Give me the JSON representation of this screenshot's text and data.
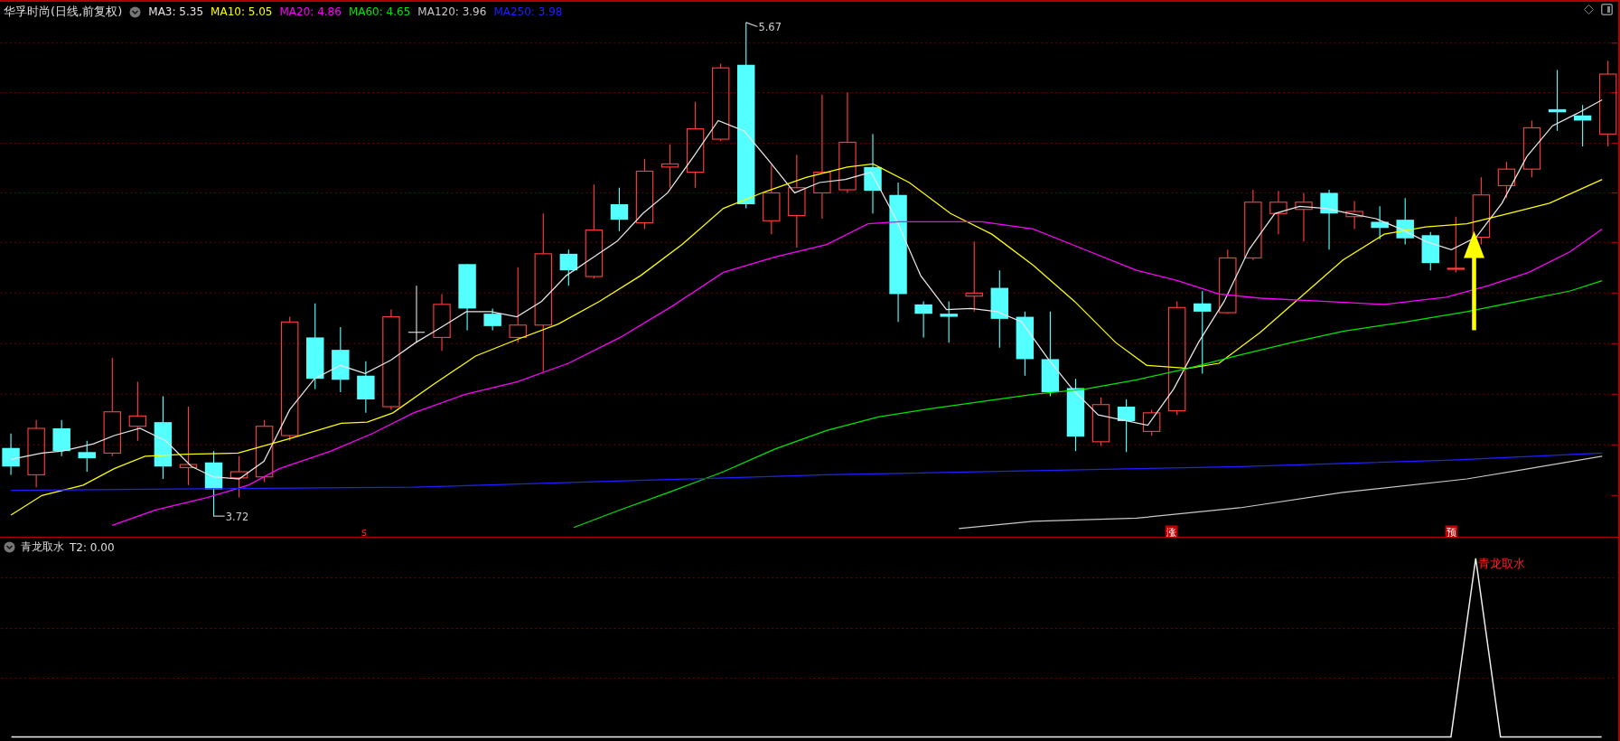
{
  "main_panel": {
    "title": "华孚时尚(日线,前复权)",
    "indicators": [
      {
        "label": "MA3: 5.35",
        "color": "#e6e6e6"
      },
      {
        "label": "MA10: 5.05",
        "color": "#ffff00"
      },
      {
        "label": "MA20: 4.86",
        "color": "#ff00ff"
      },
      {
        "label": "MA60: 4.65",
        "color": "#00e600"
      },
      {
        "label": "MA120: 3.96",
        "color": "#c8c8c8"
      },
      {
        "label": "MA250: 3.98",
        "color": "#2020ff"
      }
    ],
    "high_label": "5.67",
    "low_label": "3.72",
    "signals": [
      {
        "text": "s",
        "kind": "plain"
      },
      {
        "text": "涨",
        "kind": "boxed"
      },
      {
        "text": "预",
        "kind": "boxed"
      }
    ]
  },
  "sub_panel": {
    "title": "青龙取水",
    "value": "T2: 0.00",
    "signal_label": "青龙取水"
  }
}
